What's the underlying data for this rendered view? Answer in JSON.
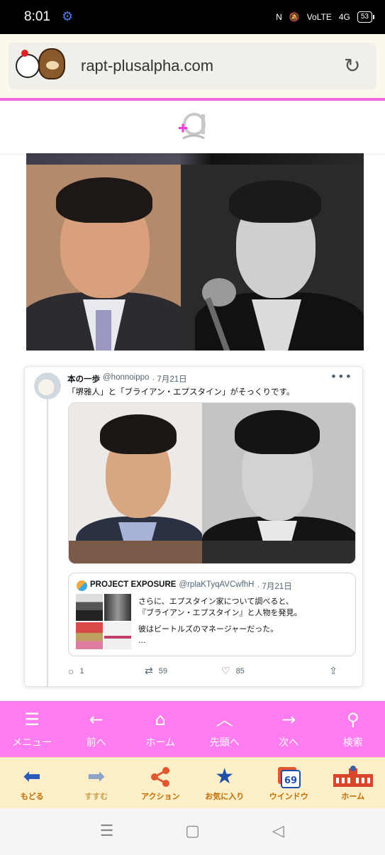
{
  "status_bar": {
    "time": "8:01",
    "indicators": [
      "N",
      "🔕",
      "VoLTE",
      "4G"
    ],
    "battery": "53"
  },
  "browser": {
    "url": "rapt-plusalpha.com"
  },
  "tweet": {
    "author_name": "本の一歩",
    "author_handle": "@honnoippo",
    "date": "· 7月21日",
    "text": "「堺雅人」と「ブライアン・エプスタイン」がそっくりです。",
    "quote": {
      "author_name": "PROJECT EXPOSURE",
      "author_handle": "@rplaKTyqAVCwfhH",
      "date": "· 7月21日",
      "lines": [
        "さらに、エプスタイン家について調べると、",
        "『ブライアン・エプスタイン』と人物を発見。",
        "彼はビートルズのマネージャーだった。",
        "..."
      ]
    },
    "replies": "1",
    "retweets": "59",
    "likes": "85"
  },
  "pink_nav": [
    {
      "label": "メニュー",
      "icon": "menu-icon"
    },
    {
      "label": "前へ",
      "icon": "arrow-left-icon"
    },
    {
      "label": "ホーム",
      "icon": "home-icon"
    },
    {
      "label": "先頭へ",
      "icon": "chevron-up-icon"
    },
    {
      "label": "次へ",
      "icon": "arrow-right-icon"
    },
    {
      "label": "検索",
      "icon": "search-icon"
    }
  ],
  "toolbar": [
    {
      "label": "もどる",
      "icon": "back-arrow-icon"
    },
    {
      "label": "すすむ",
      "icon": "forward-arrow-icon"
    },
    {
      "label": "アクション",
      "icon": "share-icon"
    },
    {
      "label": "お気に入り",
      "icon": "star-icon"
    },
    {
      "label": "ウインドウ",
      "icon": "window-icon",
      "count": "69"
    },
    {
      "label": "ホーム",
      "icon": "station-icon"
    }
  ],
  "colors": {
    "accent_pink": "#ff7df0",
    "toolbar_bg": "#fcefc8",
    "toolbar_label": "#c46a00"
  }
}
